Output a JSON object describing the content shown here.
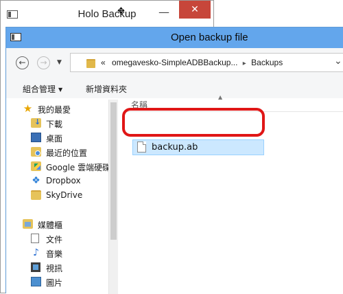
{
  "background_window": {
    "title": "Holo Backup",
    "cursor": "✥",
    "minimize": "—",
    "close": "✕"
  },
  "dialog": {
    "title": "Open backup file"
  },
  "navigation": {
    "back": "←",
    "forward": "→",
    "history": "▼",
    "path": [
      "«",
      "omegavesko-SimpleADBBackup...",
      "Backups"
    ],
    "separator": "▸",
    "dropdown": "⌄"
  },
  "toolbar": {
    "organize": "組合管理",
    "organize_arrow": "▼",
    "new_folder": "新增資料夾"
  },
  "nav_pane": {
    "favorites": "我的最愛",
    "items": [
      "下載",
      "桌面",
      "最近的位置",
      "Google 雲端硬碟",
      "Dropbox",
      "SkyDrive"
    ],
    "libraries": "媒體櫃",
    "library_items": [
      "文件",
      "音樂",
      "視訊",
      "圖片"
    ]
  },
  "content": {
    "column_name": "名稱",
    "sort": "▲",
    "files": [
      "backup.ab"
    ]
  },
  "colors": {
    "titlebar": "#63a6ec",
    "selection": "#cce8ff",
    "highlight": "#e01616",
    "close": "#c7463a"
  }
}
